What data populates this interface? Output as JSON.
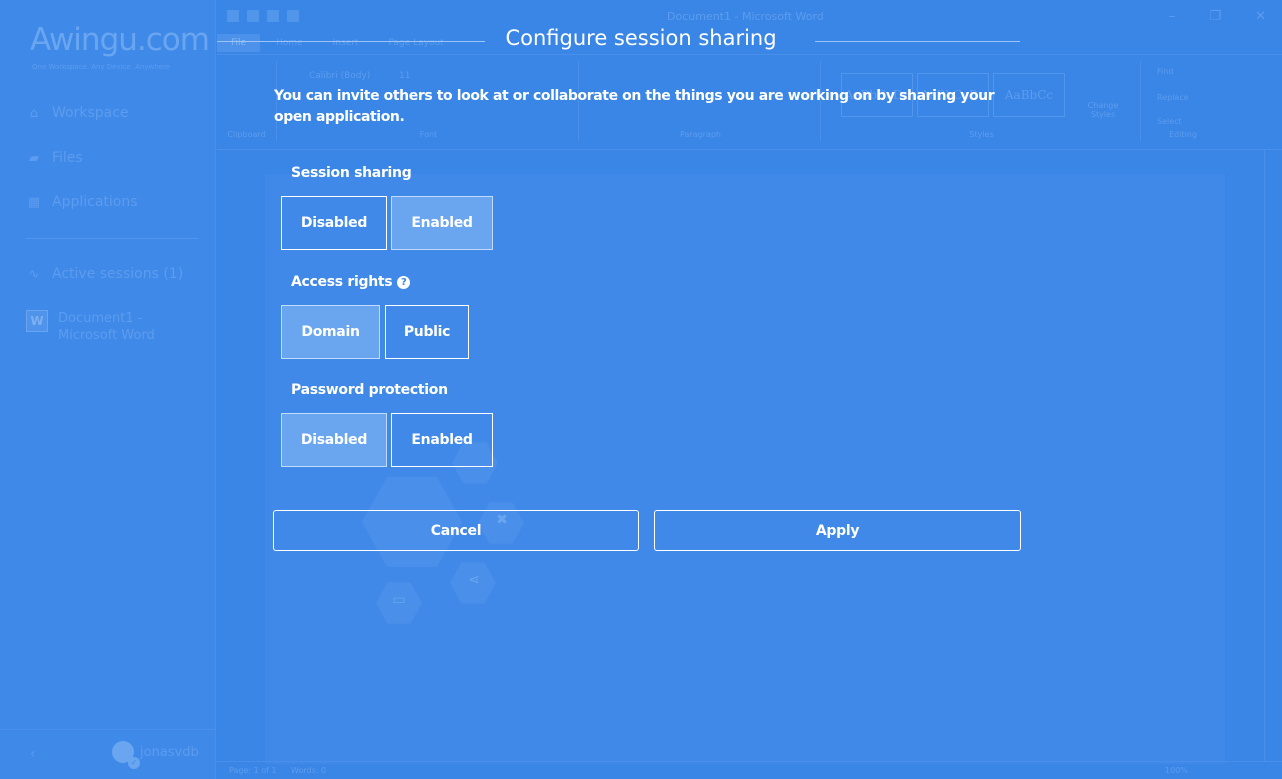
{
  "colors": {
    "overlay": "#3a86e6",
    "active_segment": "#6aa6f0",
    "text": "#ffffff"
  },
  "background": {
    "sidebar": {
      "logo": "Awingu.com",
      "tagline": "One Workspace. Any Device. Anywhere",
      "items": [
        {
          "label": "Workspace",
          "icon": "home-icon"
        },
        {
          "label": "Files",
          "icon": "folder-icon"
        },
        {
          "label": "Applications",
          "icon": "grid-icon"
        }
      ],
      "active_sessions_label": "Active sessions (1)",
      "session": {
        "badge": "W",
        "name_line1": "Document1 -",
        "name_line2": "Microsoft Word"
      },
      "user": "jonasvdb"
    },
    "word": {
      "window_title": "Document1 - Microsoft Word",
      "tabs": [
        "File",
        "Home",
        "Insert",
        "Page Layout"
      ],
      "font_name": "Calibri (Body)",
      "font_size": "11",
      "styles": [
        "AaBbCcDc",
        "AaBbCcDc",
        "AaBbCc"
      ],
      "style_names": [
        "¶ Normal",
        "¶ No Spaci...",
        "Heading 1"
      ],
      "change_styles": "Change Styles",
      "editing": [
        "Find",
        "Replace",
        "Select"
      ],
      "group_labels": [
        "Clipboard",
        "Font",
        "Paragraph",
        "Styles",
        "Editing"
      ],
      "status_left": "Page: 1 of 1",
      "status_words": "Words: 0",
      "zoom": "100%"
    }
  },
  "dialog": {
    "title": "Configure session sharing",
    "intro": "You can invite others to look at or collaborate on the things you are working on by sharing your open application.",
    "session_sharing": {
      "label": "Session sharing",
      "options": [
        "Disabled",
        "Enabled"
      ],
      "selected": "Enabled"
    },
    "access_rights": {
      "label": "Access rights",
      "options": [
        "Domain",
        "Public"
      ],
      "selected": "Domain"
    },
    "password_protection": {
      "label": "Password protection",
      "options": [
        "Disabled",
        "Enabled"
      ],
      "selected": "Disabled"
    },
    "cancel_label": "Cancel",
    "apply_label": "Apply"
  }
}
